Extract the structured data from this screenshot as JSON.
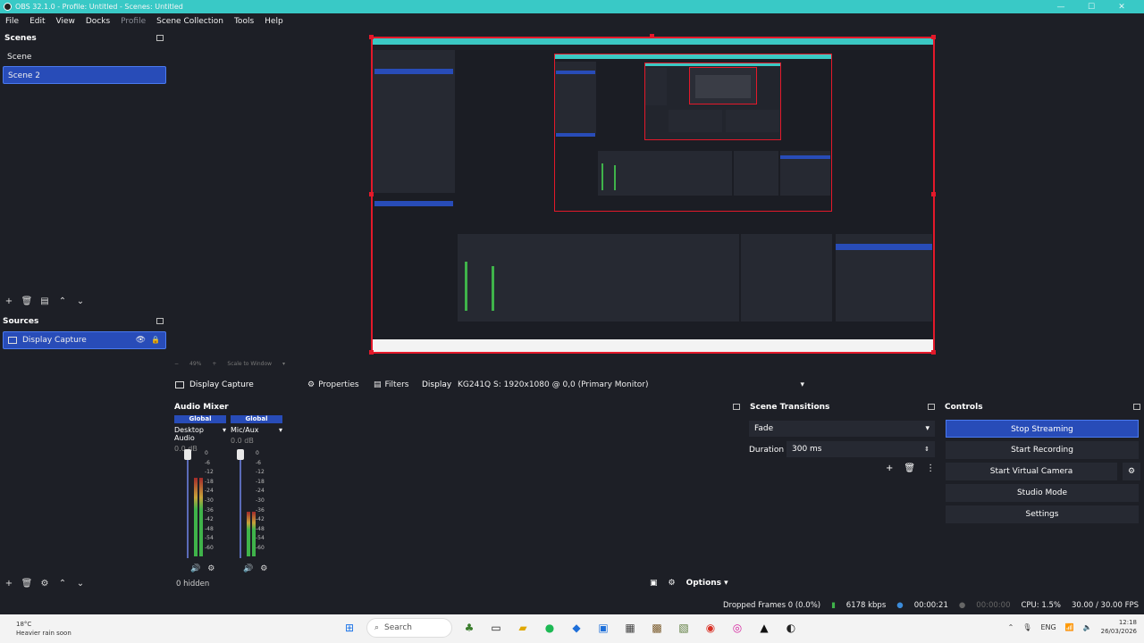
{
  "window": {
    "title": "OBS 32.1.0 - Profile: Untitled - Scenes: Untitled",
    "controls": [
      "—",
      "☐",
      "✕"
    ]
  },
  "menu": [
    "File",
    "Edit",
    "View",
    "Docks",
    "Profile",
    "Scene Collection",
    "Tools",
    "Help"
  ],
  "scenes": {
    "title": "Scenes",
    "items": [
      "Scene",
      "Scene 2"
    ],
    "selected": "Scene 2"
  },
  "sources": {
    "title": "Sources",
    "items": [
      {
        "label": "Display Capture",
        "visible": true,
        "locked": false
      }
    ]
  },
  "preview": {
    "zoom_text": "49%",
    "scale_text": "Scale to Window"
  },
  "context": {
    "source_label": "Display Capture",
    "properties_label": "Properties",
    "filters_label": "Filters",
    "display_label": "Display",
    "display_value": "KG241Q S: 1920x1080 @ 0,0 (Primary Monitor)"
  },
  "mixer": {
    "title": "Audio Mixer",
    "hidden_text": "0 hidden",
    "options_label": "Options",
    "channels": [
      {
        "badge": "Global",
        "name": "Desktop Audio",
        "db": "0.0 dB",
        "level": 0.75
      },
      {
        "badge": "Global",
        "name": "Mic/Aux",
        "db": "0.0 dB",
        "level": 0.42
      }
    ],
    "scale": [
      "0",
      "-6",
      "-12",
      "-18",
      "-24",
      "-30",
      "-36",
      "-42",
      "-48",
      "-54",
      "-60"
    ]
  },
  "transitions": {
    "title": "Scene Transitions",
    "selected": "Fade",
    "duration_label": "Duration",
    "duration_value": "300 ms"
  },
  "controls": {
    "title": "Controls",
    "buttons": [
      "Stop Streaming",
      "Start Recording",
      "Start Virtual Camera",
      "Studio Mode",
      "Settings"
    ]
  },
  "status": {
    "dropped": "Dropped Frames 0 (0.0%)",
    "bitrate": "6178 kbps",
    "stream_time": "00:00:21",
    "rec_time": "00:00:00",
    "cpu": "CPU: 1.5%",
    "fps": "30.00 / 30.00 FPS"
  },
  "taskbar": {
    "weather_temp": "18°C",
    "weather_text": "Heavier rain soon",
    "search_placeholder": "Search",
    "lang": "ENG",
    "time": "12:18",
    "date": "26/03/2026"
  },
  "colors": {
    "accent": "#284cb8",
    "titlebar": "#39c9c6",
    "preview_border": "#e3192a",
    "meter_green": "#3fb34a"
  }
}
